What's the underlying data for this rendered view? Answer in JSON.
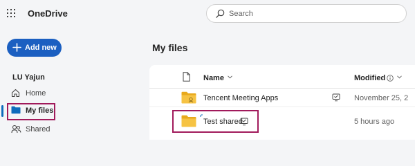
{
  "app": {
    "title": "OneDrive"
  },
  "search": {
    "placeholder": "Search"
  },
  "sidebar": {
    "add_new_label": "Add new",
    "user_name": "LU Yajun",
    "items": [
      {
        "label": "Home",
        "icon": "home-icon",
        "active": false
      },
      {
        "label": "My files",
        "icon": "folder-icon",
        "active": true
      },
      {
        "label": "Shared",
        "icon": "people-icon",
        "active": false
      }
    ]
  },
  "main": {
    "title": "My files",
    "columns": {
      "name": "Name",
      "modified": "Modified"
    },
    "rows": [
      {
        "name": "Tencent Meeting Apps",
        "modified": "November 25, 2",
        "icon": "folder-icon",
        "status_icon": "shared-icon"
      },
      {
        "name": "Test shared",
        "modified": "5 hours ago",
        "icon": "folder-icon",
        "status_icon": "shared-icon",
        "new": true
      }
    ]
  },
  "colors": {
    "accent": "#1b5fc1",
    "highlight": "#a11a5b",
    "folder": "#f6c343",
    "background": "#f4f5f7"
  }
}
